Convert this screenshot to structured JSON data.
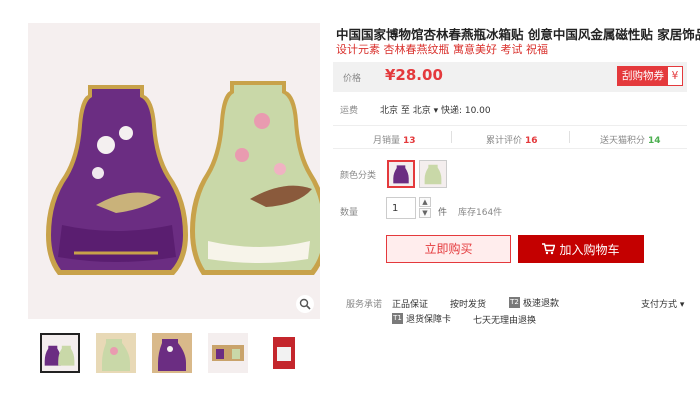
{
  "product": {
    "title": "中国国家博物馆杏林春燕瓶冰箱贴 创意中国风金属磁性贴 家居饰品",
    "subtitle": "设计元素 杏林春燕纹瓶 寓意美好 考试 祝福"
  },
  "price": {
    "label": "价格",
    "value": "¥28.00",
    "coupon_label": "刮购物券",
    "coupon_symbol": "¥"
  },
  "shipping": {
    "label": "运费",
    "text": "北京 至 北京 ▾ 快递: 10.00"
  },
  "stats": {
    "monthly_sales_label": "月销量",
    "monthly_sales": "13",
    "reviews_label": "累计评价",
    "reviews": "16",
    "points_label": "送天猫积分",
    "points": "14"
  },
  "color": {
    "label": "颜色分类",
    "options": [
      "purple",
      "green"
    ]
  },
  "quantity": {
    "label": "数量",
    "value": "1",
    "unit": "件",
    "stock": "库存164件"
  },
  "actions": {
    "buy_now": "立即购买",
    "add_cart": "加入购物车"
  },
  "services": {
    "label": "服务承诺",
    "items": [
      {
        "text": "正品保证",
        "icon": ""
      },
      {
        "text": "按时发货",
        "icon": ""
      },
      {
        "text": "极速退款",
        "icon": "T2"
      },
      {
        "text": "退货保障卡",
        "icon": "T1"
      },
      {
        "text": "七天无理由退换",
        "icon": ""
      }
    ],
    "payment": "支付方式 ▾"
  },
  "colors": {
    "accent": "#e4393c",
    "cart": "#c40000",
    "points_green": "#4caf50"
  }
}
